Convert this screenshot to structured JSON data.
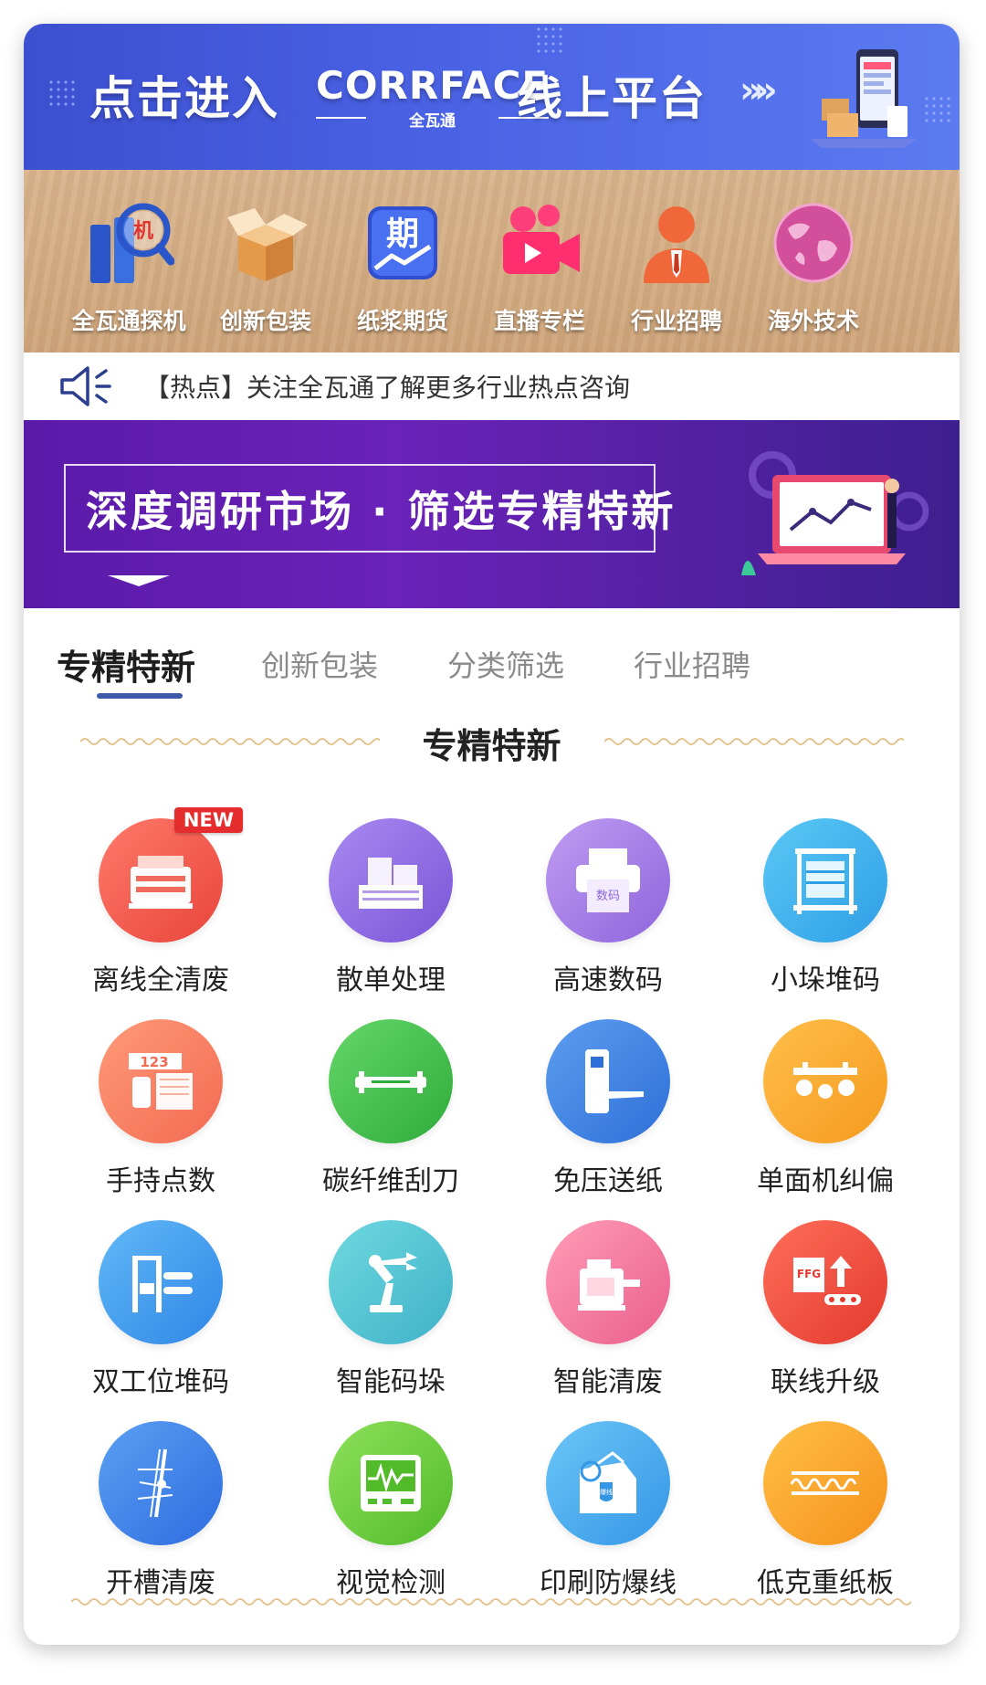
{
  "top_banner": {
    "text_left": "点击进入",
    "brand_name": "CORRFACE",
    "brand_sub": "全瓦通",
    "text_right": "线上平台",
    "arrows": "»»"
  },
  "categories": [
    {
      "label": "全瓦通探机",
      "icon": "search-machine-icon",
      "glyph": "机"
    },
    {
      "label": "创新包装",
      "icon": "box-icon"
    },
    {
      "label": "纸浆期货",
      "icon": "futures-chart-icon",
      "glyph": "期"
    },
    {
      "label": "直播专栏",
      "icon": "video-camera-icon"
    },
    {
      "label": "行业招聘",
      "icon": "person-icon"
    },
    {
      "label": "海外技术",
      "icon": "globe-icon"
    }
  ],
  "notice": {
    "text": "【热点】关注全瓦通了解更多行业热点咨询"
  },
  "promo": {
    "title": "深度调研市场 · 筛选专精特新"
  },
  "tabs": [
    {
      "label": "专精特新",
      "active": true
    },
    {
      "label": "创新包装",
      "active": false
    },
    {
      "label": "分类筛选",
      "active": false
    },
    {
      "label": "行业招聘",
      "active": false
    }
  ],
  "section": {
    "title": "专精特新"
  },
  "grid": [
    {
      "label": "离线全清废",
      "icon": "offline-waste-machine-icon",
      "color_a": "#ff7a6b",
      "color_b": "#e8443a",
      "badge": "NEW"
    },
    {
      "label": "散单处理",
      "icon": "paper-stack-icon",
      "color_a": "#a98af0",
      "color_b": "#7a55d8"
    },
    {
      "label": "高速数码",
      "icon": "digital-printer-icon",
      "color_a": "#c09cf2",
      "color_b": "#8e65dc",
      "glyph": "数码"
    },
    {
      "label": "小垛堆码",
      "icon": "shelf-rack-icon",
      "color_a": "#5ac8f5",
      "color_b": "#2f9fe6"
    },
    {
      "label": "手持点数",
      "icon": "handheld-counter-icon",
      "color_a": "#ff9a78",
      "color_b": "#f26a52",
      "glyph": "123"
    },
    {
      "label": "碳纤维刮刀",
      "icon": "scraper-blade-icon",
      "color_a": "#66d66a",
      "color_b": "#2eac3a"
    },
    {
      "label": "免压送纸",
      "icon": "paper-feeder-icon",
      "color_a": "#5d9ef0",
      "color_b": "#2d6fd8"
    },
    {
      "label": "单面机纠偏",
      "icon": "rollers-icon",
      "color_a": "#ffbf4a",
      "color_b": "#f59a1f"
    },
    {
      "label": "双工位堆码",
      "icon": "dual-station-icon",
      "color_a": "#62b9f7",
      "color_b": "#2f86e6"
    },
    {
      "label": "智能码垛",
      "icon": "robot-arm-icon",
      "color_a": "#6fd9e0",
      "color_b": "#3fb1c8"
    },
    {
      "label": "智能清废",
      "icon": "smart-waste-machine-icon",
      "color_a": "#ff9cb8",
      "color_b": "#ea5f8c"
    },
    {
      "label": "联线升级",
      "icon": "conveyor-upgrade-icon",
      "color_a": "#ff6e5a",
      "color_b": "#e23a2e",
      "glyph": "FFG"
    },
    {
      "label": "开槽清废",
      "icon": "slotting-blade-icon",
      "color_a": "#5aa0f2",
      "color_b": "#2e6ce0"
    },
    {
      "label": "视觉检测",
      "icon": "monitor-wave-icon",
      "color_a": "#8ee05a",
      "color_b": "#52bb2a"
    },
    {
      "label": "印刷防爆线",
      "icon": "anti-burst-box-icon",
      "color_a": "#6cc6f7",
      "color_b": "#3496e6",
      "glyph": "爆线"
    },
    {
      "label": "低克重纸板",
      "icon": "corrugated-board-icon",
      "color_a": "#ffbf45",
      "color_b": "#f5921c"
    }
  ],
  "colors": {
    "accent_blue": "#3d5aa8",
    "banner_blue": "#4a62e4",
    "promo_purple": "#5a1aa8",
    "kraft": "#d4ab80"
  }
}
